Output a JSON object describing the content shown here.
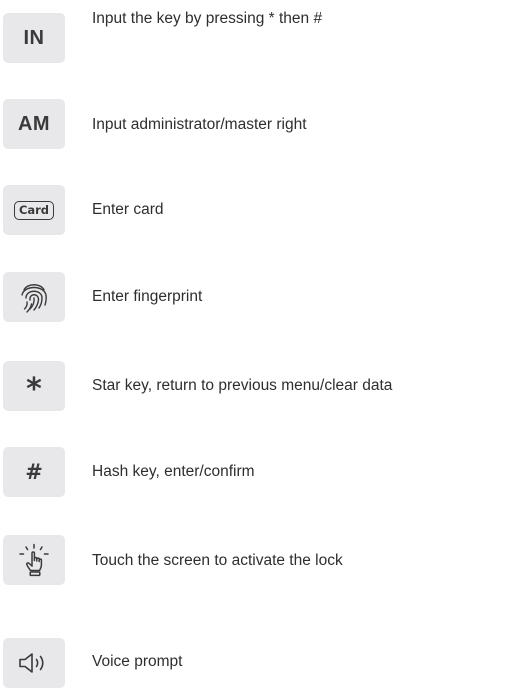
{
  "legend": {
    "items": [
      {
        "icon": "text-tile",
        "icon_text": "IN",
        "label": "Input the key by pressing * then #"
      },
      {
        "icon": "text-tile",
        "icon_text": "AM",
        "label": "Input administrator/master right"
      },
      {
        "icon": "card-icon",
        "icon_text": "Card",
        "label": "Enter card"
      },
      {
        "icon": "fingerprint-icon",
        "label": "Enter fingerprint"
      },
      {
        "icon": "star-key-icon",
        "icon_text": "*",
        "label": "Star key, return to previous menu/clear data"
      },
      {
        "icon": "hash-key-icon",
        "icon_text": "#",
        "label": "Hash key, enter/confirm"
      },
      {
        "icon": "touch-hand-icon",
        "label": "Touch the screen to activate the lock"
      },
      {
        "icon": "speaker-icon",
        "label": "Voice prompt"
      }
    ]
  },
  "colors": {
    "tile_background": "#e8e8ea",
    "icon_foreground": "#3a3a3a",
    "label_text": "#2e2e2e"
  }
}
